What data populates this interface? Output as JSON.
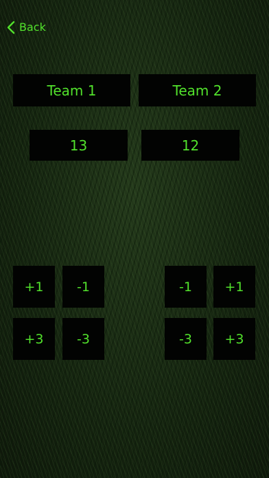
{
  "nav": {
    "back_label": "Back",
    "back_icon": "chevron-left-icon"
  },
  "teams": {
    "team1_name": "Team 1",
    "team2_name": "Team 2"
  },
  "scores": {
    "team1": "13",
    "team2": "12"
  },
  "controls": {
    "team1": {
      "plus1": "+1",
      "minus1": "-1",
      "plus3": "+3",
      "minus3": "-3"
    },
    "team2": {
      "minus1": "-1",
      "plus1": "+1",
      "minus3": "-3",
      "plus3": "+3"
    }
  },
  "colors": {
    "accent": "#52e22c",
    "box_background": "#020302",
    "background": "#14220f"
  }
}
